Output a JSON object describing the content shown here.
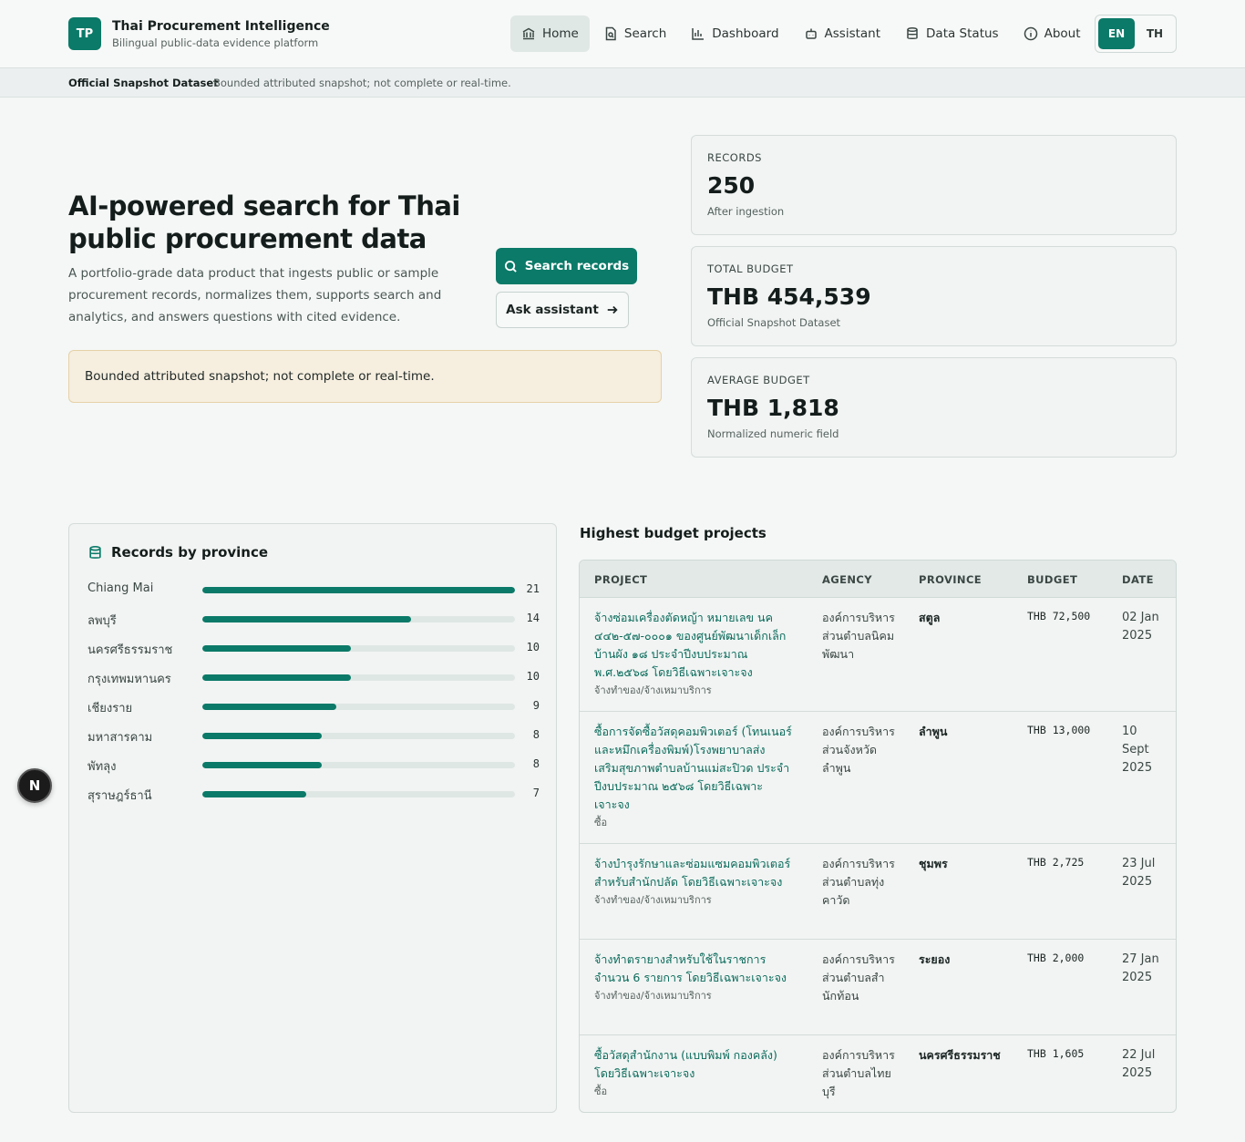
{
  "brand": {
    "logo": "TP",
    "title": "Thai Procurement Intelligence",
    "subtitle": "Bilingual public-data evidence platform"
  },
  "nav": [
    {
      "label": "Home",
      "icon": "bank-icon",
      "active": true
    },
    {
      "label": "Search",
      "icon": "document-search-icon"
    },
    {
      "label": "Dashboard",
      "icon": "bar-chart-icon"
    },
    {
      "label": "Assistant",
      "icon": "bot-icon"
    },
    {
      "label": "Data Status",
      "icon": "database-icon"
    },
    {
      "label": "About",
      "icon": "info-icon"
    }
  ],
  "lang": {
    "en": "EN",
    "th": "TH",
    "active": "EN"
  },
  "snapshot": {
    "label": "Official Snapshot Dataset",
    "text": "Bounded attributed snapshot; not complete or real-time."
  },
  "hero": {
    "title": "AI-powered search for Thai public procurement data",
    "description": "A portfolio-grade data product that ingests public or sample procurement records, normalizes them, supports search and analytics, and answers questions with cited evidence.",
    "primary_button": "Search records",
    "secondary_button": "Ask assistant",
    "notice": "Bounded attributed snapshot; not complete or real-time."
  },
  "stats": [
    {
      "label": "RECORDS",
      "value": "250",
      "sub": "After ingestion"
    },
    {
      "label": "TOTAL BUDGET",
      "value": "THB 454,539",
      "sub": "Official Snapshot Dataset"
    },
    {
      "label": "AVERAGE BUDGET",
      "value": "THB 1,818",
      "sub": "Normalized numeric field"
    }
  ],
  "provinces": {
    "title": "Records by province",
    "max": 21,
    "items": [
      {
        "name": "Chiang Mai",
        "count": 21
      },
      {
        "name": "ลพบุรี",
        "count": 14
      },
      {
        "name": "นครศรีธรรมราช",
        "count": 10
      },
      {
        "name": "กรุงเทพมหานคร",
        "count": 10
      },
      {
        "name": "เชียงราย",
        "count": 9
      },
      {
        "name": "มหาสารคาม",
        "count": 8
      },
      {
        "name": "พัทลุง",
        "count": 8
      },
      {
        "name": "สุราษฎร์ธานี",
        "count": 7
      }
    ]
  },
  "projects": {
    "title": "Highest budget projects",
    "columns": [
      "PROJECT",
      "AGENCY",
      "PROVINCE",
      "BUDGET",
      "DATE"
    ],
    "rows": [
      {
        "title": "จ้างซ่อมเครื่องตัดหญ้า หมายเลข นค ๔๔๒-๕๗-๐๐๐๑ ของศูนย์พัฒนาเด็กเล็กบ้านผัง ๑๘ ประจำปีงบประมาณ พ.ศ.๒๕๖๘ โดยวิธีเฉพาะเจาะจง",
        "category": "จ้างทำของ/จ้างเหมาบริการ",
        "agency": "องค์การบริหารส่วนตำบลนิคมพัฒนา",
        "province": "สตูล",
        "budget": "THB 72,500",
        "date": "02 Jan 2025"
      },
      {
        "title": "ซื้อการจัดซื้อวัสดุคอมพิวเตอร์ (โทนเนอร์และหมึกเครื่องพิมพ์)โรงพยาบาลส่งเสริมสุขภาพตำบลบ้านแม่สะปิวด ประจำปีงบประมาณ ๒๕๖๘ โดยวิธีเฉพาะเจาะจง",
        "category": "ซื้อ",
        "agency": "องค์การบริหารส่วนจังหวัดลำพูน",
        "province": "ลำพูน",
        "budget": "THB 13,000",
        "date": "10 Sept 2025"
      },
      {
        "title": "จ้างบำรุงรักษาและซ่อมแซมคอมพิวเตอร์ สำหรับสำนักปลัด โดยวิธีเฉพาะเจาะจง",
        "category": "จ้างทำของ/จ้างเหมาบริการ",
        "agency": "องค์การบริหารส่วนตำบลทุ่งคาวัด",
        "province": "ชุมพร",
        "budget": "THB 2,725",
        "date": "23 Jul 2025"
      },
      {
        "title": "จ้างทำตรายางสำหรับใช้ในราชการ จำนวน 6 รายการ โดยวิธีเฉพาะเจาะจง",
        "category": "จ้างทำของ/จ้างเหมาบริการ",
        "agency": "องค์การบริหารส่วนตำบลสำนักท้อน",
        "province": "ระยอง",
        "budget": "THB 2,000",
        "date": "27 Jan 2025"
      },
      {
        "title": "ซื้อวัสดุสำนักงาน (แบบพิมพ์ กองคลัง) โดยวิธีเฉพาะเจาะจง",
        "category": "ซื้อ",
        "agency": "องค์การบริหารส่วนตำบลไทยบุรี",
        "province": "นครศรีธรรมราช",
        "budget": "THB 1,605",
        "date": "22 Jul 2025"
      }
    ]
  },
  "floating": {
    "label": "N"
  },
  "colors": {
    "accent": "#0b7a68",
    "notice_bg": "#f6eedf"
  }
}
